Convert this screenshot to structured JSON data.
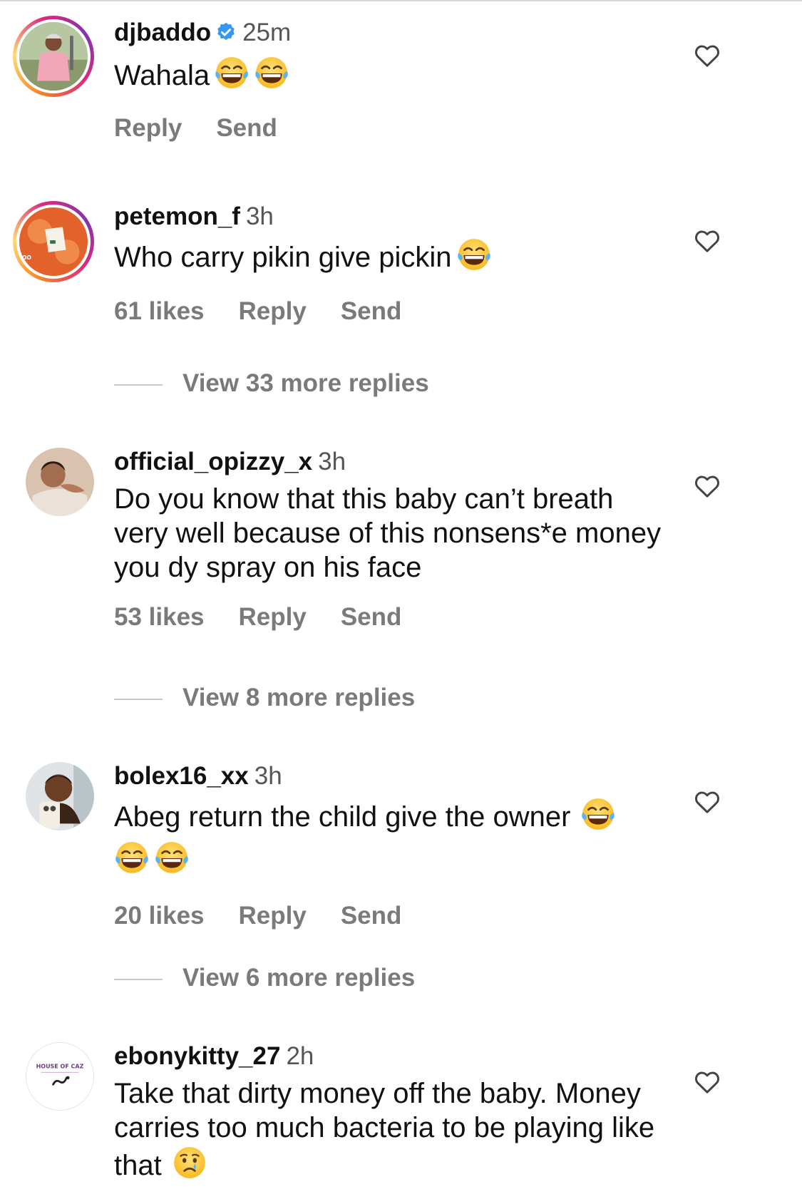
{
  "comments": [
    {
      "username": "djbaddo",
      "verified": true,
      "time": "25m",
      "text": "Wahala",
      "emojis": [
        "tears-of-joy",
        "tears-of-joy"
      ],
      "likes": "",
      "reply": "Reply",
      "send": "Send",
      "view_replies": ""
    },
    {
      "username": "petemon_f",
      "verified": false,
      "time": "3h",
      "text": "Who carry pikin give pickin",
      "emojis": [
        "tears-of-joy"
      ],
      "likes": "61 likes",
      "reply": "Reply",
      "send": "Send",
      "view_replies": "View 33 more replies"
    },
    {
      "username": "official_opizzy_x",
      "verified": false,
      "time": "3h",
      "text": "Do you know that this baby can’t breath very well because of this nonsens*e money you dy spray on his face",
      "emojis": [],
      "likes": "53 likes",
      "reply": "Reply",
      "send": "Send",
      "view_replies": "View 8 more replies"
    },
    {
      "username": "bolex16_xx",
      "verified": false,
      "time": "3h",
      "text": "Abeg return the child give the owner",
      "emojis": [
        "tears-of-joy",
        "tears-of-joy",
        "tears-of-joy"
      ],
      "likes": "20 likes",
      "reply": "Reply",
      "send": "Send",
      "view_replies": "View 6 more replies"
    },
    {
      "username": "ebonykitty_27",
      "verified": false,
      "time": "2h",
      "text": "Take that dirty money off the baby. Money carries too much bacteria to be playing like that",
      "emojis": [
        "crying-face"
      ],
      "likes": "",
      "reply": "",
      "send": "",
      "view_replies": ""
    }
  ],
  "avatar_logo_text": "HOUSE OF CAZ",
  "colors": {
    "verified": "#3897f0",
    "muted": "#7a7a7a",
    "ring_start": "#f58529",
    "ring_end": "#dd2a7b"
  }
}
